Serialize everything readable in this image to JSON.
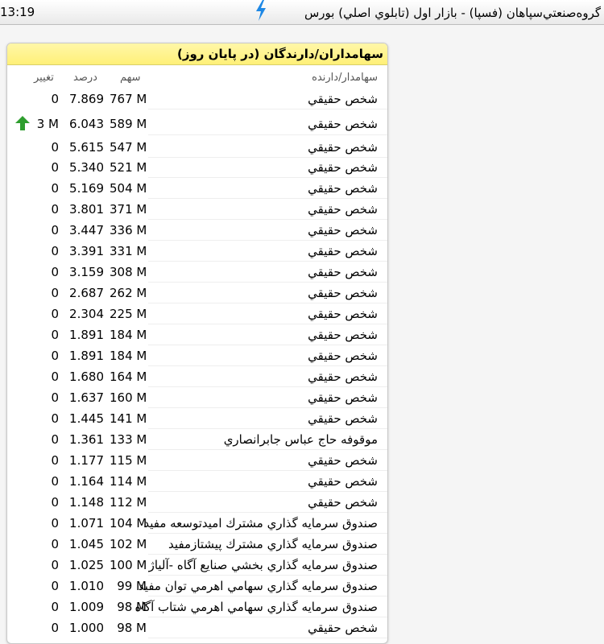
{
  "status_bar": {
    "time": "13:19",
    "title": "گروه‌صنعتي‌سپاهان (فسپا) - بازار اول (تابلوي اصلي) بورس"
  },
  "panel": {
    "title": "سهامداران/دارندگان (در پایان روز)",
    "columns": {
      "holder": "سهامدار/دارنده",
      "shares": "سهم",
      "percent": "درصد",
      "change": "تغییر"
    }
  },
  "rows": [
    {
      "holder": "شخص حقيقي",
      "shares": "767 M",
      "percent": "7.869",
      "change": "0"
    },
    {
      "holder": "شخص حقيقي",
      "shares": "589 M",
      "percent": "6.043",
      "change": "3 M",
      "up": true
    },
    {
      "holder": "شخص حقيقي",
      "shares": "547 M",
      "percent": "5.615",
      "change": "0"
    },
    {
      "holder": "شخص حقيقي",
      "shares": "521 M",
      "percent": "5.340",
      "change": "0"
    },
    {
      "holder": "شخص حقيقي",
      "shares": "504 M",
      "percent": "5.169",
      "change": "0"
    },
    {
      "holder": "شخص حقيقي",
      "shares": "371 M",
      "percent": "3.801",
      "change": "0"
    },
    {
      "holder": "شخص حقيقي",
      "shares": "336 M",
      "percent": "3.447",
      "change": "0"
    },
    {
      "holder": "شخص حقيقي",
      "shares": "331 M",
      "percent": "3.391",
      "change": "0"
    },
    {
      "holder": "شخص حقيقي",
      "shares": "308 M",
      "percent": "3.159",
      "change": "0"
    },
    {
      "holder": "شخص حقيقي",
      "shares": "262 M",
      "percent": "2.687",
      "change": "0"
    },
    {
      "holder": "شخص حقيقي",
      "shares": "225 M",
      "percent": "2.304",
      "change": "0"
    },
    {
      "holder": "شخص حقيقي",
      "shares": "184 M",
      "percent": "1.891",
      "change": "0"
    },
    {
      "holder": "شخص حقيقي",
      "shares": "184 M",
      "percent": "1.891",
      "change": "0"
    },
    {
      "holder": "شخص حقيقي",
      "shares": "164 M",
      "percent": "1.680",
      "change": "0"
    },
    {
      "holder": "شخص حقيقي",
      "shares": "160 M",
      "percent": "1.637",
      "change": "0"
    },
    {
      "holder": "شخص حقيقي",
      "shares": "141 M",
      "percent": "1.445",
      "change": "0"
    },
    {
      "holder": "موقوفه حاج عباس جابرانصاري",
      "shares": "133 M",
      "percent": "1.361",
      "change": "0"
    },
    {
      "holder": "شخص حقيقي",
      "shares": "115 M",
      "percent": "1.177",
      "change": "0"
    },
    {
      "holder": "شخص حقيقي",
      "shares": "114 M",
      "percent": "1.164",
      "change": "0"
    },
    {
      "holder": "شخص حقيقي",
      "shares": "112 M",
      "percent": "1.148",
      "change": "0"
    },
    {
      "holder": "صندوق سرمايه گذاري مشترك اميدتوسعه مفيد",
      "shares": "104 M",
      "percent": "1.071",
      "change": "0"
    },
    {
      "holder": "صندوق سرمايه گذاري مشترك پيشتازمفيد",
      "shares": "102 M",
      "percent": "1.045",
      "change": "0"
    },
    {
      "holder": "صندوق سرمايه گذاري بخشي صنايع آگاه -آلياژ",
      "shares": "100 M",
      "percent": "1.025",
      "change": "0"
    },
    {
      "holder": "صندوق سرمايه گذاري سهامي اهرمي توان مفيد",
      "shares": "99 M",
      "percent": "1.010",
      "change": "0"
    },
    {
      "holder": "صندوق سرمايه گذاري سهامي اهرمي شتاب آگاه",
      "shares": "98 M",
      "percent": "1.009",
      "change": "0"
    },
    {
      "holder": "شخص حقيقي",
      "shares": "98 M",
      "percent": "1.000",
      "change": "0"
    }
  ],
  "colors": {
    "header_bg": "#fff078",
    "up_arrow": "#2e9e2e",
    "bolt": "#1e88e5"
  },
  "icons": {
    "status_icon": "lightning-bolt-icon",
    "change_indicator": "arrow-up-icon"
  }
}
